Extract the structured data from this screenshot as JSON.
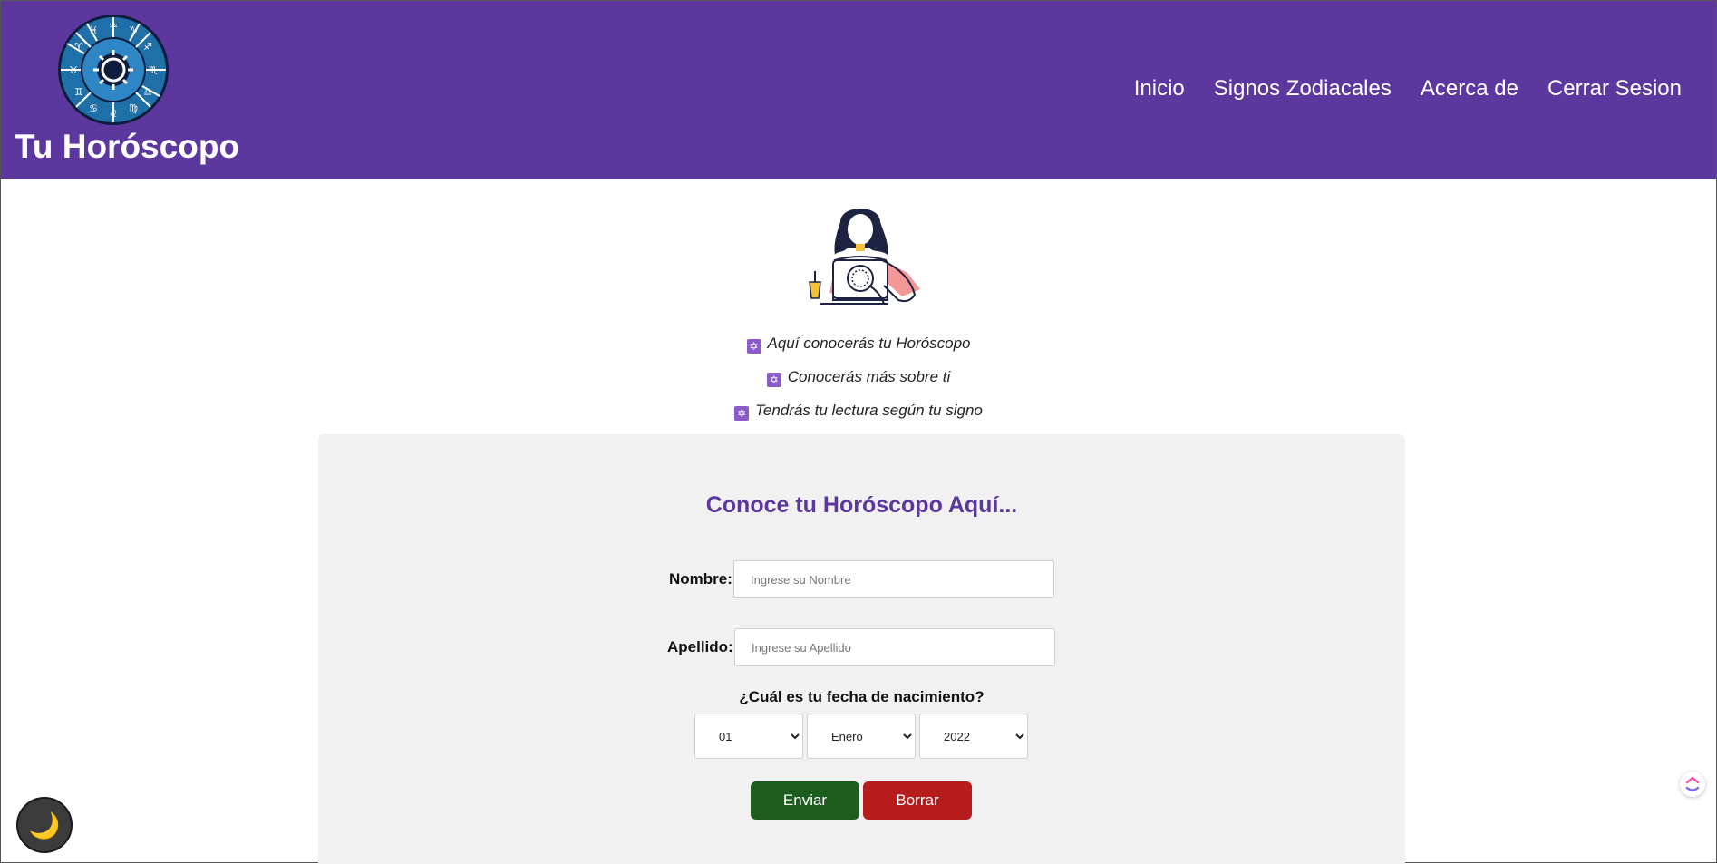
{
  "header": {
    "brand": "Tu Horóscopo",
    "nav": [
      "Inicio",
      "Signos Zodiacales",
      "Acerca de",
      "Cerrar Sesion"
    ]
  },
  "features": [
    {
      "icon": "star-of-david-icon",
      "text": "Aquí conocerás tu Horóscopo"
    },
    {
      "icon": "star-of-david-icon",
      "text": "Conocerás más sobre ti"
    },
    {
      "icon": "star-of-david-icon",
      "text": "Tendrás tu lectura según tu signo"
    }
  ],
  "form": {
    "title": "Conoce tu Horóscopo Aquí...",
    "nombre_label": "Nombre:",
    "nombre_placeholder": "Ingrese su Nombre",
    "apellido_label": "Apellido:",
    "apellido_placeholder": "Ingrese su Apellido",
    "dob_label": "¿Cuál es tu fecha de nacimiento?",
    "day": "01",
    "month": "Enero",
    "year": "2022",
    "submit": "Enviar",
    "reset": "Borrar"
  },
  "widgets": {
    "theme_toggle_icon": "🌙"
  },
  "colors": {
    "header": "#5c379e",
    "title": "#5c379e",
    "submit": "#1d5c1f",
    "reset": "#b71c1c"
  }
}
